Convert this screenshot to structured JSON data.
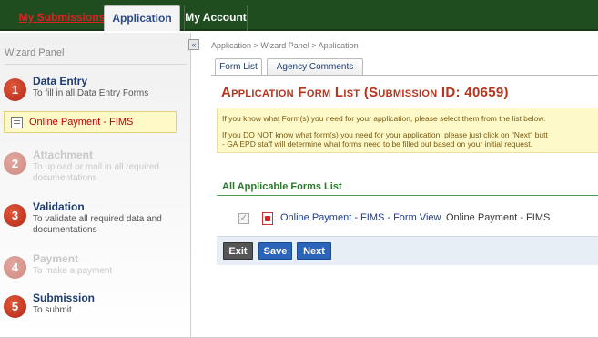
{
  "topnav": {
    "my_submissions": "My Submissions",
    "application": "Application",
    "my_account": "My Account"
  },
  "sidebar": {
    "title": "Wizard Panel",
    "active_item": "Online Payment - FIMS",
    "steps": [
      {
        "num": "1",
        "title": "Data Entry",
        "desc": "To fill in all Data Entry Forms",
        "enabled": true
      },
      {
        "num": "2",
        "title": "Attachment",
        "desc": "To upload or mail in all required documentations",
        "enabled": false
      },
      {
        "num": "3",
        "title": "Validation",
        "desc": "To validate all required data and documentations",
        "enabled": true
      },
      {
        "num": "4",
        "title": "Payment",
        "desc": "To make a payment",
        "enabled": false
      },
      {
        "num": "5",
        "title": "Submission",
        "desc": "To submit",
        "enabled": true
      }
    ]
  },
  "collapse_glyph": "«",
  "breadcrumb": "Application > Wizard Panel > Application",
  "subtabs": [
    "Form List",
    "Agency Comments"
  ],
  "main": {
    "title": "Application Form List (Submission ID: 40659)",
    "info_line1": "If you know what Form(s) you need for your application, please select them from the list below.",
    "info_line2": "If you DO NOT know what form(s) you need for your application, please just click on \"Next\" butt",
    "info_line3": "- GA EPD staff will determine what forms need to be filled out based on your initial request.",
    "section_title": "All Applicable Forms List",
    "form_row": {
      "checkbox_glyph": "✓",
      "link": "Online Payment - FIMS - Form View",
      "name": "Online Payment - FIMS"
    },
    "buttons": {
      "exit": "Exit",
      "save": "Save",
      "next": "Next"
    }
  },
  "colors": {
    "nav_bg": "#1f4d1f",
    "title_red": "#b8341c",
    "step_red": "#c0392b",
    "button_blue": "#2b64b8",
    "info_bg": "#fdf9c9"
  }
}
